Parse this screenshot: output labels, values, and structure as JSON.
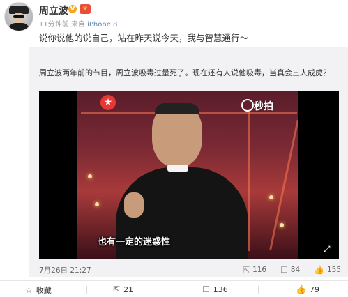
{
  "post": {
    "username": "周立波",
    "verified_badge": "V",
    "member_badge": "会员",
    "time_ago": "11分钟前",
    "source_prefix": "来自",
    "source_device": "iPhone 8",
    "text": "说你说他的说自己，站在昨天说今天，我与智慧通行～"
  },
  "quoted": {
    "text": "周立波两年前的节目，周立波吸毒过量死了。现在还有人说他吸毒，当真会三人成虎？",
    "video": {
      "watermark": "秒拍",
      "subtitle": "也有一定的迷惑性"
    },
    "date": "7月26日 21:27",
    "reposts": "116",
    "comments": "84",
    "likes": "155"
  },
  "actions": {
    "favorite_label": "收藏",
    "repost_count": "21",
    "comment_count": "136",
    "like_count": "79"
  },
  "icons": {
    "favorite": "star-icon",
    "repost": "share-icon",
    "comment": "comment-icon",
    "like": "thumbs-up-icon"
  },
  "colors": {
    "link_blue": "#5b86b5",
    "quote_bg": "#f2f2f5",
    "verified": "#f5a623"
  }
}
